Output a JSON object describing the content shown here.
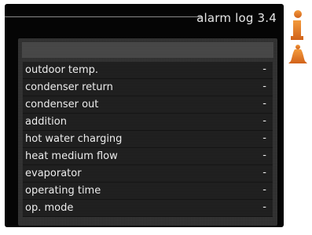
{
  "header": {
    "title": "alarm log 3.4"
  },
  "rows": [
    {
      "label": "outdoor temp.",
      "value": "-"
    },
    {
      "label": "condenser return",
      "value": "-"
    },
    {
      "label": "condenser out",
      "value": "-"
    },
    {
      "label": "addition",
      "value": "-"
    },
    {
      "label": "hot water charging",
      "value": "-"
    },
    {
      "label": "heat medium flow",
      "value": "-"
    },
    {
      "label": "evaporator",
      "value": "-"
    },
    {
      "label": "operating time",
      "value": "-"
    },
    {
      "label": "op. mode",
      "value": "-"
    }
  ],
  "side_icons": [
    {
      "name": "info-icon",
      "color": "#e87722"
    },
    {
      "name": "alarm-bell-icon",
      "color": "#e87722"
    }
  ]
}
